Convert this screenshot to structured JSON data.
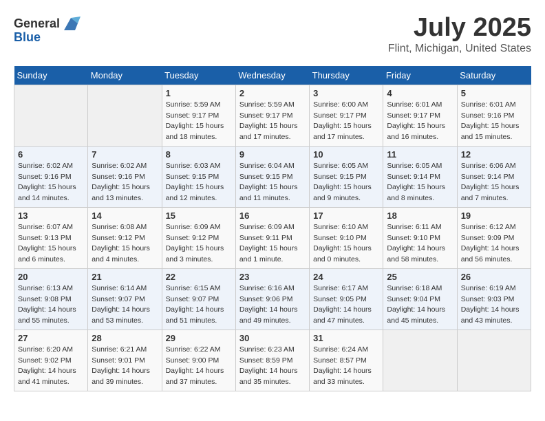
{
  "header": {
    "logo_general": "General",
    "logo_blue": "Blue",
    "main_title": "July 2025",
    "subtitle": "Flint, Michigan, United States"
  },
  "weekdays": [
    "Sunday",
    "Monday",
    "Tuesday",
    "Wednesday",
    "Thursday",
    "Friday",
    "Saturday"
  ],
  "weeks": [
    [
      {
        "day": "",
        "detail": ""
      },
      {
        "day": "",
        "detail": ""
      },
      {
        "day": "1",
        "detail": "Sunrise: 5:59 AM\nSunset: 9:17 PM\nDaylight: 15 hours and 18 minutes."
      },
      {
        "day": "2",
        "detail": "Sunrise: 5:59 AM\nSunset: 9:17 PM\nDaylight: 15 hours and 17 minutes."
      },
      {
        "day": "3",
        "detail": "Sunrise: 6:00 AM\nSunset: 9:17 PM\nDaylight: 15 hours and 17 minutes."
      },
      {
        "day": "4",
        "detail": "Sunrise: 6:01 AM\nSunset: 9:17 PM\nDaylight: 15 hours and 16 minutes."
      },
      {
        "day": "5",
        "detail": "Sunrise: 6:01 AM\nSunset: 9:16 PM\nDaylight: 15 hours and 15 minutes."
      }
    ],
    [
      {
        "day": "6",
        "detail": "Sunrise: 6:02 AM\nSunset: 9:16 PM\nDaylight: 15 hours and 14 minutes."
      },
      {
        "day": "7",
        "detail": "Sunrise: 6:02 AM\nSunset: 9:16 PM\nDaylight: 15 hours and 13 minutes."
      },
      {
        "day": "8",
        "detail": "Sunrise: 6:03 AM\nSunset: 9:15 PM\nDaylight: 15 hours and 12 minutes."
      },
      {
        "day": "9",
        "detail": "Sunrise: 6:04 AM\nSunset: 9:15 PM\nDaylight: 15 hours and 11 minutes."
      },
      {
        "day": "10",
        "detail": "Sunrise: 6:05 AM\nSunset: 9:15 PM\nDaylight: 15 hours and 9 minutes."
      },
      {
        "day": "11",
        "detail": "Sunrise: 6:05 AM\nSunset: 9:14 PM\nDaylight: 15 hours and 8 minutes."
      },
      {
        "day": "12",
        "detail": "Sunrise: 6:06 AM\nSunset: 9:14 PM\nDaylight: 15 hours and 7 minutes."
      }
    ],
    [
      {
        "day": "13",
        "detail": "Sunrise: 6:07 AM\nSunset: 9:13 PM\nDaylight: 15 hours and 6 minutes."
      },
      {
        "day": "14",
        "detail": "Sunrise: 6:08 AM\nSunset: 9:12 PM\nDaylight: 15 hours and 4 minutes."
      },
      {
        "day": "15",
        "detail": "Sunrise: 6:09 AM\nSunset: 9:12 PM\nDaylight: 15 hours and 3 minutes."
      },
      {
        "day": "16",
        "detail": "Sunrise: 6:09 AM\nSunset: 9:11 PM\nDaylight: 15 hours and 1 minute."
      },
      {
        "day": "17",
        "detail": "Sunrise: 6:10 AM\nSunset: 9:10 PM\nDaylight: 15 hours and 0 minutes."
      },
      {
        "day": "18",
        "detail": "Sunrise: 6:11 AM\nSunset: 9:10 PM\nDaylight: 14 hours and 58 minutes."
      },
      {
        "day": "19",
        "detail": "Sunrise: 6:12 AM\nSunset: 9:09 PM\nDaylight: 14 hours and 56 minutes."
      }
    ],
    [
      {
        "day": "20",
        "detail": "Sunrise: 6:13 AM\nSunset: 9:08 PM\nDaylight: 14 hours and 55 minutes."
      },
      {
        "day": "21",
        "detail": "Sunrise: 6:14 AM\nSunset: 9:07 PM\nDaylight: 14 hours and 53 minutes."
      },
      {
        "day": "22",
        "detail": "Sunrise: 6:15 AM\nSunset: 9:07 PM\nDaylight: 14 hours and 51 minutes."
      },
      {
        "day": "23",
        "detail": "Sunrise: 6:16 AM\nSunset: 9:06 PM\nDaylight: 14 hours and 49 minutes."
      },
      {
        "day": "24",
        "detail": "Sunrise: 6:17 AM\nSunset: 9:05 PM\nDaylight: 14 hours and 47 minutes."
      },
      {
        "day": "25",
        "detail": "Sunrise: 6:18 AM\nSunset: 9:04 PM\nDaylight: 14 hours and 45 minutes."
      },
      {
        "day": "26",
        "detail": "Sunrise: 6:19 AM\nSunset: 9:03 PM\nDaylight: 14 hours and 43 minutes."
      }
    ],
    [
      {
        "day": "27",
        "detail": "Sunrise: 6:20 AM\nSunset: 9:02 PM\nDaylight: 14 hours and 41 minutes."
      },
      {
        "day": "28",
        "detail": "Sunrise: 6:21 AM\nSunset: 9:01 PM\nDaylight: 14 hours and 39 minutes."
      },
      {
        "day": "29",
        "detail": "Sunrise: 6:22 AM\nSunset: 9:00 PM\nDaylight: 14 hours and 37 minutes."
      },
      {
        "day": "30",
        "detail": "Sunrise: 6:23 AM\nSunset: 8:59 PM\nDaylight: 14 hours and 35 minutes."
      },
      {
        "day": "31",
        "detail": "Sunrise: 6:24 AM\nSunset: 8:57 PM\nDaylight: 14 hours and 33 minutes."
      },
      {
        "day": "",
        "detail": ""
      },
      {
        "day": "",
        "detail": ""
      }
    ]
  ]
}
